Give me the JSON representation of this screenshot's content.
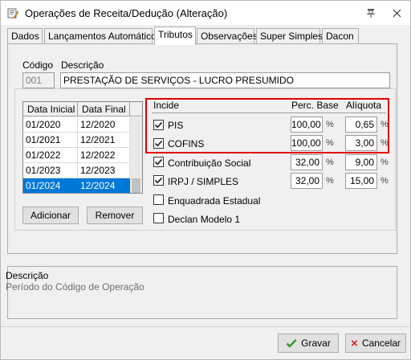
{
  "window": {
    "title": "Operações de Receita/Dedução (Alteração)"
  },
  "tabs": [
    {
      "label": "Dados"
    },
    {
      "label": "Lançamentos Automáticos"
    },
    {
      "label": "Tributos"
    },
    {
      "label": "Observações"
    },
    {
      "label": "Super Simples"
    },
    {
      "label": "Dacon"
    }
  ],
  "header": {
    "codigo_label": "Código",
    "descricao_label": "Descrição",
    "codigo_value": "001",
    "descricao_value": "PRESTAÇÃO DE SERVIÇOS - LUCRO PRESUMIDO"
  },
  "periods": {
    "columns": [
      "Data Inicial",
      "Data Final"
    ],
    "rows": [
      [
        "01/2020",
        "12/2020"
      ],
      [
        "01/2021",
        "12/2021"
      ],
      [
        "01/2022",
        "12/2022"
      ],
      [
        "01/2023",
        "12/2023"
      ],
      [
        "01/2024",
        "12/2024"
      ]
    ],
    "selected_row": 4
  },
  "buttons": {
    "adicionar": "Adicionar",
    "remover": "Remover",
    "gravar": "Gravar",
    "cancelar": "Cancelar"
  },
  "taxes": {
    "col_incide": "Incide",
    "col_perc_base": "Perc. Base",
    "col_aliquota": "Alíquota",
    "percent_symbol": "%",
    "items": [
      {
        "name": "PIS",
        "checked": true,
        "perc_base": "100,00",
        "aliquota": "0,65"
      },
      {
        "name": "COFINS",
        "checked": true,
        "perc_base": "100,00",
        "aliquota": "3,00"
      },
      {
        "name": "Contribuição Social",
        "checked": true,
        "perc_base": "32,00",
        "aliquota": "9,00"
      },
      {
        "name": "IRPJ / SIMPLES",
        "checked": true,
        "perc_base": "32,00",
        "aliquota": "15,00"
      }
    ],
    "extra": [
      {
        "name": "Enquadrada Estadual",
        "checked": false
      },
      {
        "name": "Declan Modelo 1",
        "checked": false
      }
    ],
    "highlight_color": "#e00000"
  },
  "footer": {
    "descricao_label": "Descrição",
    "descricao_text": "Período do Código de Operação"
  },
  "colors": {
    "selection": "#0078d7",
    "check_green": "#2e9a2e",
    "cancel_red": "#d21f1f"
  }
}
